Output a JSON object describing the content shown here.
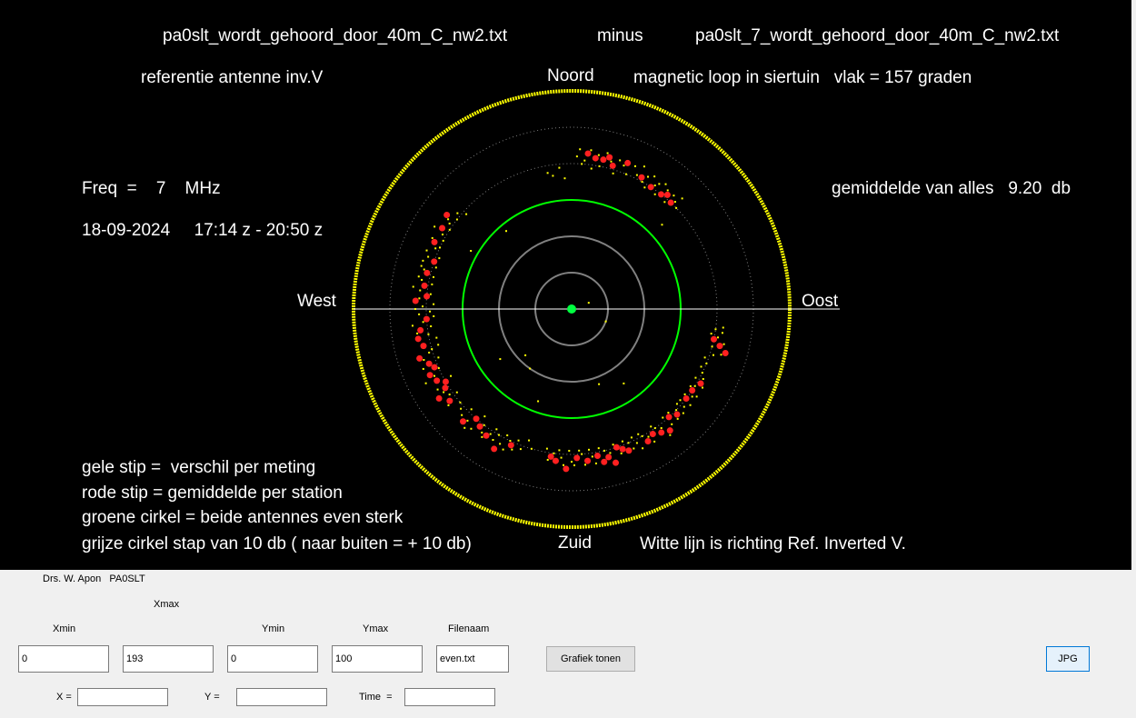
{
  "plot": {
    "file_left": "pa0slt_wordt_gehoord_door_40m_C_nw2.txt",
    "operator_word": "minus",
    "file_right": "pa0slt_7_wordt_gehoord_door_40m_C_nw2.txt",
    "reference_antenna": "referentie antenne inv.V",
    "north": "Noord",
    "south": "Zuid",
    "west": "West",
    "east": "Oost",
    "loop_description": "magnetic loop in siertuin   vlak = 157 graden",
    "freq": "Freq  =    7    MHz",
    "datetime": "18-09-2024     17:14 z - 20:50 z",
    "average": "gemiddelde van alles   9.20  db",
    "legend_yellow": "gele stip =  verschil per meting",
    "legend_red": "rode stip = gemiddelde per station",
    "legend_green": "groene cirkel = beide antennes even sterk",
    "legend_grey": "grijze cirkel stap van 10 db ( naar buiten = + 10 db)",
    "white_line_note": "Witte lijn is richting Ref. Inverted V."
  },
  "colors": {
    "background": "#000000",
    "outer_circle": "#ffff00",
    "green_circle": "#00ff00",
    "grey_circle": "#808080",
    "yellow_dot": "#ffff00",
    "red_dot": "#ff2020",
    "center_dot": "#00ff40",
    "white_line": "#ffffff"
  },
  "chart_data": {
    "type": "scatter",
    "coordinate_system": "polar",
    "radial_step_db": 10,
    "green_circle_db": 0,
    "grey_circles_db": [
      -30,
      -20,
      -10,
      10,
      20
    ],
    "outer_circle_db": 30,
    "average_db": 9.2,
    "red_points_bearing_deg_db": [
      [
        6,
        13
      ],
      [
        9,
        12
      ],
      [
        12,
        12
      ],
      [
        14,
        13
      ],
      [
        16,
        11
      ],
      [
        21,
        13
      ],
      [
        28,
        11
      ],
      [
        33,
        10
      ],
      [
        38,
        10
      ],
      [
        40,
        11
      ],
      [
        43,
        10
      ],
      [
        279,
        11
      ],
      [
        284,
        11
      ],
      [
        289,
        10
      ],
      [
        296,
        12
      ],
      [
        302,
        12
      ],
      [
        307,
        13
      ],
      [
        275,
        10
      ],
      [
        273,
        13
      ],
      [
        266,
        10
      ],
      [
        262,
        12
      ],
      [
        259,
        13
      ],
      [
        256,
        12
      ],
      [
        252,
        14
      ],
      [
        249,
        12
      ],
      [
        247,
        11
      ],
      [
        245,
        13
      ],
      [
        242,
        12
      ],
      [
        240,
        10
      ],
      [
        238,
        11
      ],
      [
        236,
        14
      ],
      [
        233,
        12
      ],
      [
        224,
        13
      ],
      [
        221,
        10
      ],
      [
        218,
        11
      ],
      [
        214,
        12
      ],
      [
        209,
        14
      ],
      [
        204,
        11
      ],
      [
        188,
        11
      ],
      [
        186,
        12
      ],
      [
        182,
        14
      ],
      [
        178,
        11
      ],
      [
        174,
        12
      ],
      [
        170,
        11
      ],
      [
        168,
        13
      ],
      [
        166,
        12
      ],
      [
        164,
        14
      ],
      [
        162,
        10
      ],
      [
        160,
        11
      ],
      [
        158,
        12
      ],
      [
        150,
        12
      ],
      [
        147,
        11
      ],
      [
        144,
        12
      ],
      [
        141,
        13
      ],
      [
        138,
        10
      ],
      [
        135,
        11
      ],
      [
        128,
        10
      ],
      [
        124,
        10
      ],
      [
        120,
        11
      ],
      [
        102,
        10
      ],
      [
        104,
        12
      ],
      [
        106,
        14
      ]
    ],
    "yellow_points_bearing_deg_db": [
      [
        2,
        12
      ],
      [
        3,
        14
      ],
      [
        4,
        10
      ],
      [
        5,
        11
      ],
      [
        7,
        14
      ],
      [
        8,
        9
      ],
      [
        10,
        13
      ],
      [
        11,
        10
      ],
      [
        13,
        14
      ],
      [
        15,
        12
      ],
      [
        17,
        9
      ],
      [
        18,
        13
      ],
      [
        20,
        12
      ],
      [
        22,
        10
      ],
      [
        24,
        13
      ],
      [
        26,
        11
      ],
      [
        27,
        14
      ],
      [
        29,
        10
      ],
      [
        30,
        12
      ],
      [
        31,
        9
      ],
      [
        32,
        13
      ],
      [
        34,
        11
      ],
      [
        35,
        12
      ],
      [
        36,
        9
      ],
      [
        37,
        13
      ],
      [
        39,
        12
      ],
      [
        41,
        9
      ],
      [
        42,
        12
      ],
      [
        44,
        11
      ],
      [
        45,
        13
      ],
      [
        46,
        10
      ],
      [
        255,
        8
      ],
      [
        254,
        10
      ],
      [
        253,
        11
      ],
      [
        251,
        13
      ],
      [
        250,
        9
      ],
      [
        248,
        14
      ],
      [
        246,
        10
      ],
      [
        244,
        12
      ],
      [
        243,
        15
      ],
      [
        241,
        8
      ],
      [
        239,
        13
      ],
      [
        237,
        12
      ],
      [
        235,
        11
      ],
      [
        234,
        9
      ],
      [
        232,
        13
      ],
      [
        230,
        10
      ],
      [
        228,
        11
      ],
      [
        226,
        12
      ],
      [
        225,
        9
      ],
      [
        223,
        12
      ],
      [
        222,
        14
      ],
      [
        220,
        13
      ],
      [
        219,
        8
      ],
      [
        217,
        10
      ],
      [
        216,
        12
      ],
      [
        215,
        13
      ],
      [
        213,
        11
      ],
      [
        212,
        9
      ],
      [
        211,
        12
      ],
      [
        210,
        10
      ],
      [
        208,
        12
      ],
      [
        207,
        9
      ],
      [
        206,
        13
      ],
      [
        205,
        10
      ],
      [
        203,
        12
      ],
      [
        202,
        9
      ],
      [
        200,
        11
      ],
      [
        198,
        8
      ],
      [
        196,
        10
      ],
      [
        258,
        8
      ],
      [
        260,
        10
      ],
      [
        261,
        13
      ],
      [
        263,
        9
      ],
      [
        264,
        14
      ],
      [
        265,
        11
      ],
      [
        267,
        8
      ],
      [
        268,
        12
      ],
      [
        269,
        9
      ],
      [
        270,
        13
      ],
      [
        271,
        11
      ],
      [
        272,
        8
      ],
      [
        274,
        12
      ],
      [
        276,
        9
      ],
      [
        277,
        12
      ],
      [
        278,
        14
      ],
      [
        280,
        9
      ],
      [
        281,
        12
      ],
      [
        282,
        13
      ],
      [
        283,
        9
      ],
      [
        285,
        12
      ],
      [
        286,
        13
      ],
      [
        287,
        9
      ],
      [
        288,
        13
      ],
      [
        290,
        12
      ],
      [
        291,
        9
      ],
      [
        292,
        13
      ],
      [
        294,
        11
      ],
      [
        295,
        10
      ],
      [
        297,
        13
      ],
      [
        298,
        10
      ],
      [
        300,
        11
      ],
      [
        301,
        14
      ],
      [
        303,
        10
      ],
      [
        305,
        11
      ],
      [
        306,
        12
      ],
      [
        308,
        10
      ],
      [
        310,
        11
      ],
      [
        312,
        9
      ],
      [
        190,
        9
      ],
      [
        189,
        12
      ],
      [
        187,
        10
      ],
      [
        185,
        9
      ],
      [
        184,
        11
      ],
      [
        183,
        13
      ],
      [
        181,
        9
      ],
      [
        180,
        12
      ],
      [
        179,
        13
      ],
      [
        177,
        9
      ],
      [
        176,
        10
      ],
      [
        175,
        13
      ],
      [
        173,
        9
      ],
      [
        172,
        11
      ],
      [
        171,
        13
      ],
      [
        169,
        9
      ],
      [
        167,
        10
      ],
      [
        165,
        11
      ],
      [
        163,
        9
      ],
      [
        161,
        12
      ],
      [
        159,
        9
      ],
      [
        157,
        10
      ],
      [
        156,
        12
      ],
      [
        155,
        9
      ],
      [
        154,
        11
      ],
      [
        153,
        13
      ],
      [
        152,
        9
      ],
      [
        151,
        10
      ],
      [
        149,
        11
      ],
      [
        148,
        13
      ],
      [
        146,
        9
      ],
      [
        145,
        10
      ],
      [
        143,
        11
      ],
      [
        142,
        14
      ],
      [
        140,
        9
      ],
      [
        139,
        12
      ],
      [
        137,
        9
      ],
      [
        136,
        12
      ],
      [
        134,
        10
      ],
      [
        133,
        12
      ],
      [
        132,
        9
      ],
      [
        131,
        11
      ],
      [
        130,
        9
      ],
      [
        129,
        12
      ],
      [
        127,
        9
      ],
      [
        126,
        11
      ],
      [
        125,
        12
      ],
      [
        123,
        9
      ],
      [
        122,
        10
      ],
      [
        121,
        12
      ],
      [
        119,
        9
      ],
      [
        118,
        11
      ],
      [
        116,
        10
      ],
      [
        114,
        9
      ],
      [
        112,
        10
      ],
      [
        110,
        9
      ],
      [
        108,
        11
      ],
      [
        107,
        13
      ],
      [
        105,
        10
      ],
      [
        103,
        13
      ],
      [
        101,
        11
      ],
      [
        100,
        9
      ],
      [
        99,
        12
      ],
      [
        98,
        10
      ],
      [
        97,
        12
      ],
      [
        350,
        8
      ],
      [
        352,
        7
      ],
      [
        355,
        9
      ],
      [
        357,
        6
      ],
      [
        47,
        4
      ],
      [
        70,
        -25
      ],
      [
        110,
        -20
      ],
      [
        145,
        -5
      ],
      [
        160,
        -8
      ],
      [
        200,
        -3
      ],
      [
        215,
        -10
      ],
      [
        225,
        -12
      ],
      [
        235,
        -6
      ],
      [
        300,
        2
      ],
      [
        320,
        -2
      ]
    ]
  },
  "panel": {
    "author": "Drs. W. Apon   PA0SLT",
    "xmin_label": "Xmin",
    "xmax_label": "Xmax",
    "ymin_label": "Ymin",
    "ymax_label": "Ymax",
    "filename_label": "Filenaam",
    "xmin_value": "0",
    "xmax_value": "193",
    "ymin_value": "0",
    "ymax_value": "100",
    "filename_value": "even.txt",
    "show_button": "Grafiek tonen",
    "jpg_button": "JPG",
    "x_label": "X =",
    "y_label": "Y =",
    "time_label": "Time  =",
    "x_value": "",
    "y_value": "",
    "time_value": ""
  }
}
